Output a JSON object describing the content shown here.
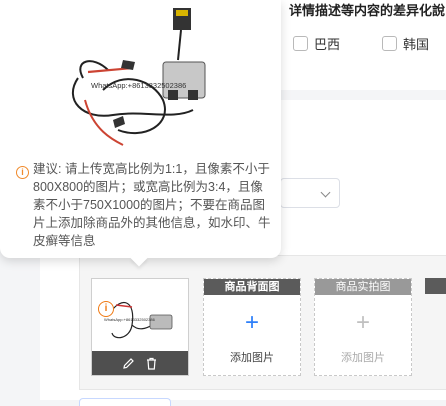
{
  "header": {
    "heading": "详情描述等内容的差异化說",
    "checkboxes": [
      {
        "label": "巴西",
        "checked": false
      },
      {
        "label": "韩国",
        "checked": false
      }
    ]
  },
  "popover": {
    "watermark_text": "WhatsApp:+8613332502386",
    "advice_text": "建议:  请上传宽高比例为1:1，且像素不小于800X800的图片；或宽高比例为3:4，且像素不小于750X1000的图片；不要在商品图片上添加除商品外的其他信息，如水印、牛皮癣等信息",
    "warning_color": "#f08a2b"
  },
  "images": {
    "uploaded": {
      "watermark_text": "WhatsApp:+8613332502386",
      "actions": [
        "edit-icon",
        "trash-icon"
      ]
    },
    "slots": [
      {
        "label": "商品背面图",
        "add_text": "添加图片",
        "enabled": true
      },
      {
        "label": "商品实拍图",
        "add_text": "添加图片",
        "enabled": false
      }
    ],
    "plus_glyph": "+"
  },
  "colors": {
    "accent": "#2d7ff9",
    "warning": "#f07a14",
    "label_bar_dark": "#5b5b5b",
    "label_bar_light": "#999999"
  }
}
